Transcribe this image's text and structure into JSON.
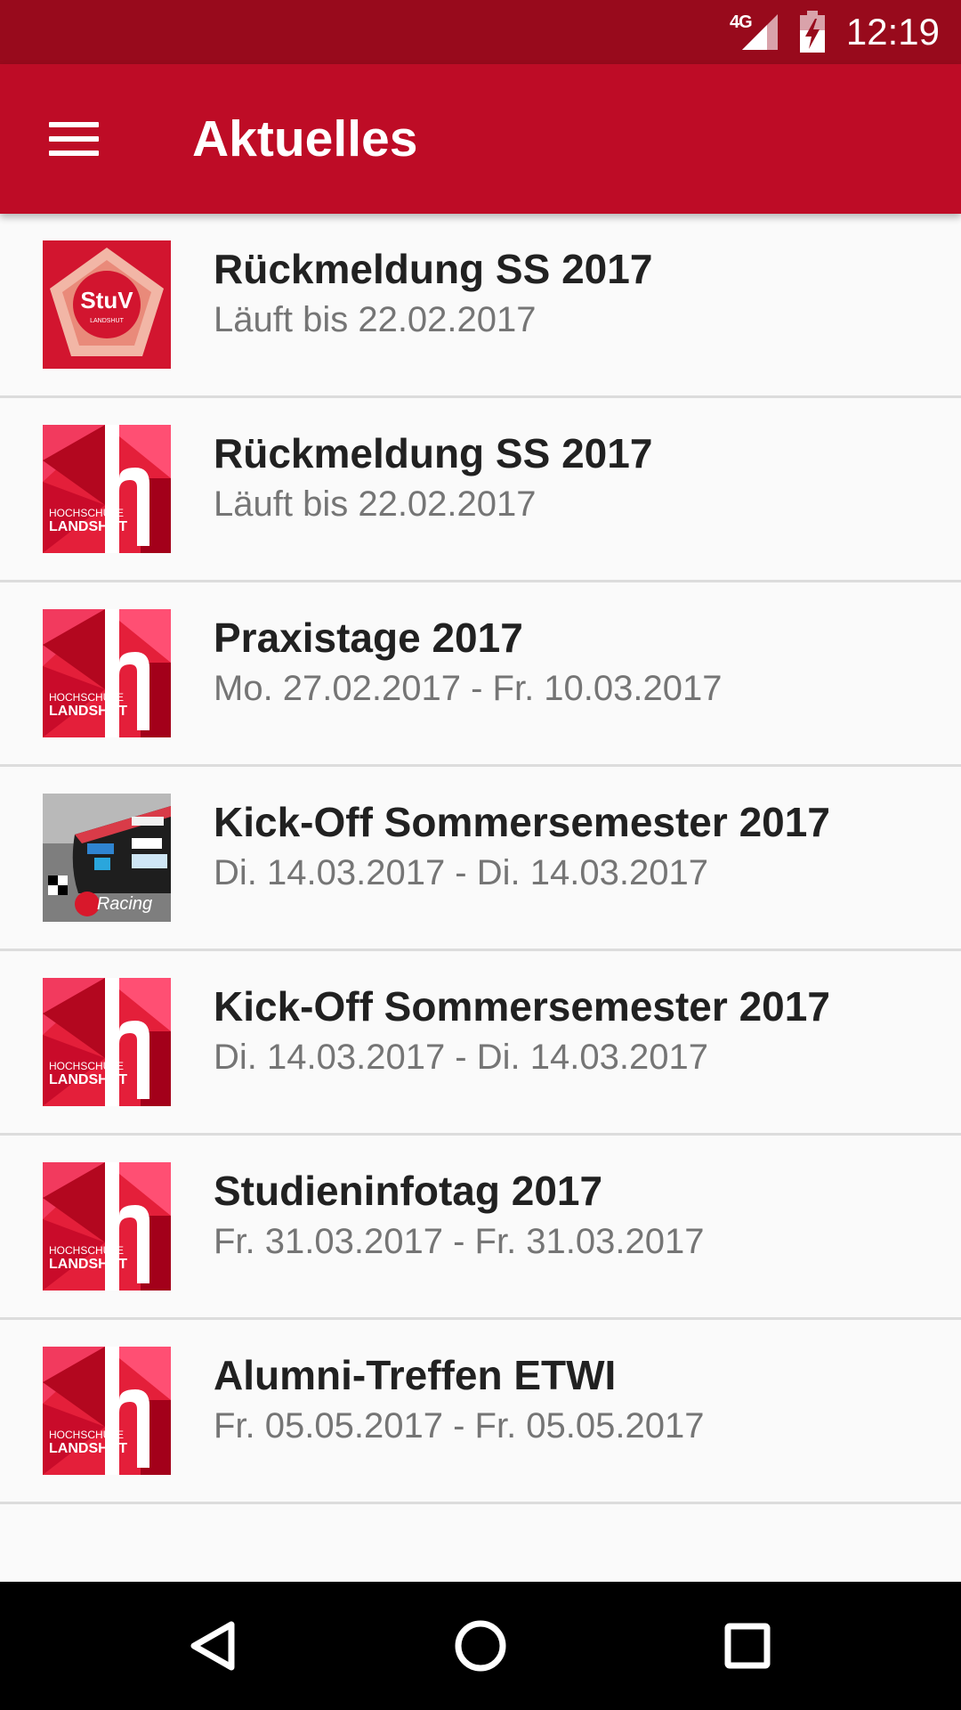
{
  "status_bar": {
    "network": "4G",
    "time": "12:19"
  },
  "app_bar": {
    "title": "Aktuelles"
  },
  "items": [
    {
      "title": "Rückmeldung SS 2017",
      "subtitle": "Läuft bis 22.02.2017",
      "thumb": "stuv-logo"
    },
    {
      "title": "Rückmeldung SS 2017",
      "subtitle": "Läuft bis 22.02.2017",
      "thumb": "hochschule-landshut-logo"
    },
    {
      "title": "Praxistage 2017",
      "subtitle": "Mo. 27.02.2017 - Fr. 10.03.2017",
      "thumb": "hochschule-landshut-logo"
    },
    {
      "title": "Kick-Off Sommersemester 2017",
      "subtitle": "Di. 14.03.2017 - Di. 14.03.2017",
      "thumb": "racing-car-photo"
    },
    {
      "title": "Kick-Off Sommersemester 2017",
      "subtitle": "Di. 14.03.2017 - Di. 14.03.2017",
      "thumb": "hochschule-landshut-logo"
    },
    {
      "title": "Studieninfotag 2017",
      "subtitle": "Fr. 31.03.2017 - Fr. 31.03.2017",
      "thumb": "hochschule-landshut-logo"
    },
    {
      "title": "Alumni-Treffen ETWI",
      "subtitle": "Fr. 05.05.2017 - Fr. 05.05.2017",
      "thumb": "hochschule-landshut-logo"
    }
  ],
  "logos": {
    "stuv_name": "StuV",
    "stuv_city": "LANDSHUT",
    "hs_line1": "HOCHSCHULE",
    "hs_line2": "LANDSHUT",
    "racing_text": "Racing"
  },
  "colors": {
    "status_bar": "#980a1c",
    "app_bar": "#be0c26",
    "title_text": "#212121",
    "subtitle_text": "#757575",
    "divider": "#dcdcdc"
  },
  "navigation": {
    "back": "back-icon",
    "home": "home-icon",
    "recents": "recents-icon"
  }
}
